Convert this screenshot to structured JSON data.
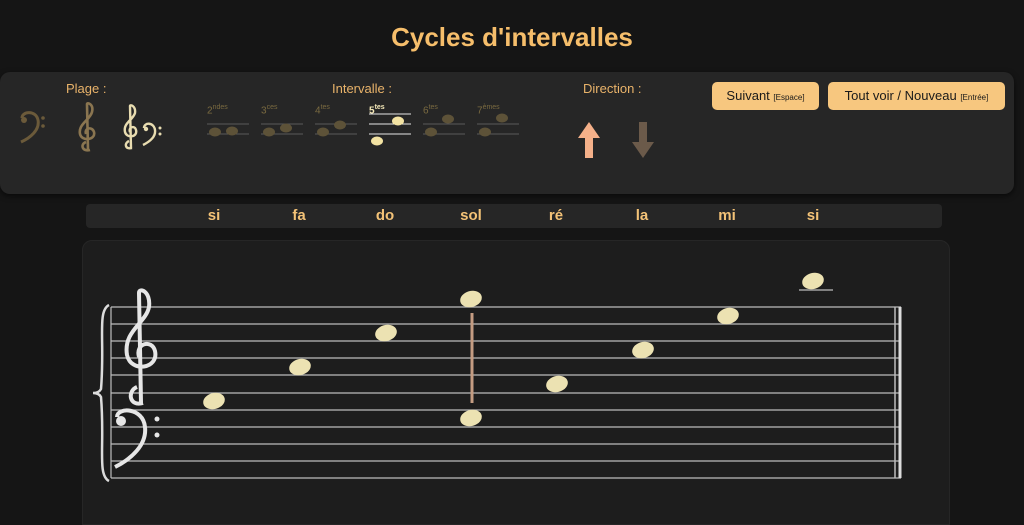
{
  "title": "Cycles d'intervalles",
  "range": {
    "label": "Plage :",
    "options": [
      "bass-clef",
      "treble-clef",
      "grand-staff"
    ]
  },
  "interval": {
    "label": "Intervalle :",
    "options": [
      {
        "num": "2",
        "suffix": "ndes",
        "active": false
      },
      {
        "num": "3",
        "suffix": "ces",
        "active": false
      },
      {
        "num": "4",
        "suffix": "tes",
        "active": false
      },
      {
        "num": "5",
        "suffix": "tes",
        "active": true
      },
      {
        "num": "6",
        "suffix": "tes",
        "active": false
      },
      {
        "num": "7",
        "suffix": "èmes",
        "active": false
      }
    ]
  },
  "direction": {
    "label": "Direction :",
    "up_icon": "arrow-up-icon",
    "down_icon": "arrow-down-icon",
    "selected": "up"
  },
  "buttons": {
    "next_label": "Suivant",
    "next_hint": "[Espace]",
    "show_label": "Tout voir / Nouveau",
    "show_hint": "[Entrée]"
  },
  "notes": [
    "si",
    "fa",
    "do",
    "sol",
    "ré",
    "la",
    "mi",
    "si"
  ],
  "colors": {
    "accent": "#f6be6b",
    "button": "#f7c77f",
    "note": "#ece2b2",
    "up_arrow": "#f4b089",
    "down_arrow": "#6b5a4a"
  }
}
